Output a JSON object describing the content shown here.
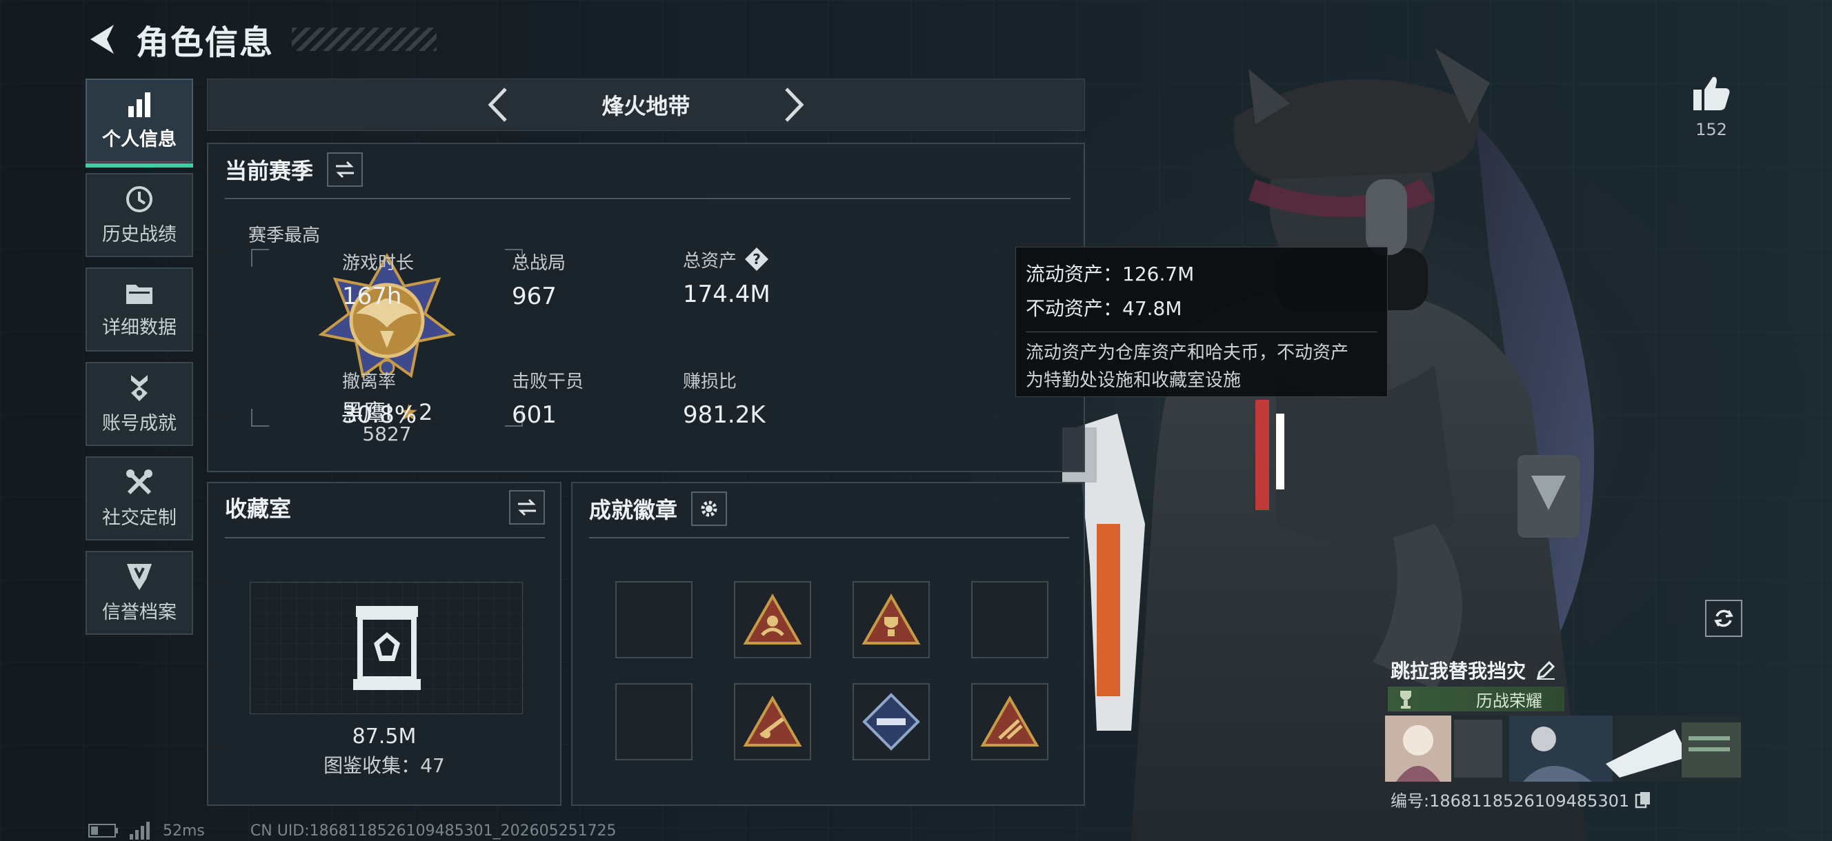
{
  "header": {
    "title": "角色信息"
  },
  "nav": [
    {
      "label": "个人信息",
      "icon": "bar-chart-icon",
      "active": true
    },
    {
      "label": "历史战绩",
      "icon": "history-clock-icon"
    },
    {
      "label": "详细数据",
      "icon": "folder-icon"
    },
    {
      "label": "账号成就",
      "icon": "medal-icon"
    },
    {
      "label": "社交定制",
      "icon": "tools-icon"
    },
    {
      "label": "信誉档案",
      "icon": "shield-badge-icon"
    }
  ],
  "mode": {
    "title": "烽火地带"
  },
  "season": {
    "title": "当前赛季",
    "best_label": "赛季最高",
    "rank_name": "黑鹰I",
    "rank_stars": "2",
    "rank_score": "5827",
    "stats": [
      {
        "label": "游戏时长",
        "value": "167h"
      },
      {
        "label": "总战局",
        "value": "967"
      },
      {
        "label": "总资产",
        "value": "174.4M"
      },
      {
        "label": "撤离率",
        "value": "30.8%"
      },
      {
        "label": "击败干员",
        "value": "601"
      },
      {
        "label": "赚损比",
        "value": "981.2K"
      }
    ]
  },
  "tooltip": {
    "liquid": "流动资产：126.7M",
    "fixed": "不动资产：47.8M",
    "note_line1": "流动资产为仓库资产和哈夫币，不动资产",
    "note_line2": "为特勤处设施和收藏室设施"
  },
  "collection": {
    "title": "收藏室",
    "value": "87.5M",
    "count": "图鉴收集：47"
  },
  "achievements": {
    "title": "成就徽章"
  },
  "player": {
    "likes": "152",
    "name": "跳拉我替我挡灾",
    "honor": "历战荣耀",
    "id": "编号:1868118526109485301"
  },
  "footer": {
    "ping": "52ms",
    "uid": "CN UID:1868118526109485301_202605251725"
  },
  "colors": {
    "accent": "#3ecfa3",
    "gold": "#c79a45",
    "panel": "#1e262c"
  }
}
